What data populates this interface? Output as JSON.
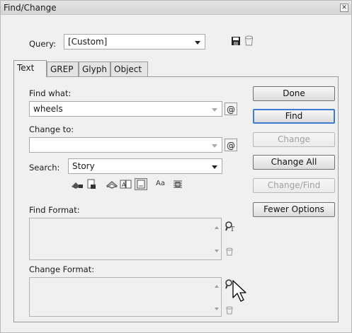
{
  "window": {
    "title": "Find/Change"
  },
  "query": {
    "label": "Query:",
    "value": "[Custom]"
  },
  "tabs": [
    "Text",
    "GREP",
    "Glyph",
    "Object"
  ],
  "find_what": {
    "label": "Find what:",
    "value": "wheels"
  },
  "change_to": {
    "label": "Change to:",
    "value": ""
  },
  "search": {
    "label": "Search:",
    "value": "Story"
  },
  "find_format": {
    "label": "Find Format:"
  },
  "change_format": {
    "label": "Change Format:"
  },
  "option_icons": {
    "case_label": "Aa"
  },
  "buttons": {
    "done": "Done",
    "find": "Find",
    "change": "Change",
    "change_all": "Change All",
    "change_find": "Change/Find",
    "fewer_options": "Fewer Options"
  },
  "colors": {
    "default_button_border": "#3d7bd1",
    "disabled_text": "#a0a0a0"
  }
}
